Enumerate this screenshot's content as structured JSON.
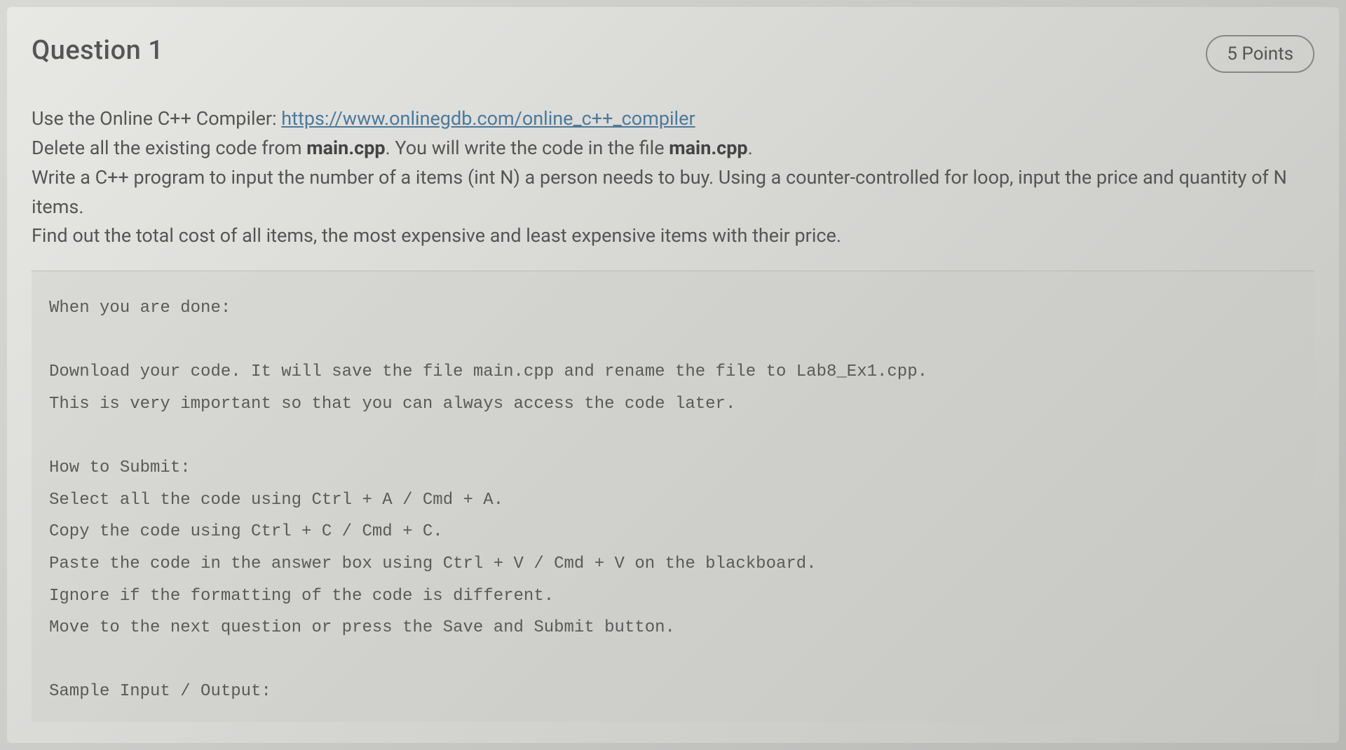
{
  "question": {
    "title": "Question 1",
    "points": "5 Points",
    "body": {
      "line1_prefix": "Use the Online C++ Compiler: ",
      "line1_link": "https://www.onlinegdb.com/online_c++_compiler",
      "line2_prefix": "Delete all the existing code from ",
      "line2_bold1": "main.cpp",
      "line2_mid": ". You will write the code in the file ",
      "line2_bold2": "main.cpp",
      "line2_suffix": ".",
      "line3": "Write a C++ program to input the number of a items (int N) a person needs to buy. Using a counter-controlled for loop, input the price and quantity of N items.",
      "line4": "Find out the total cost of all items, the most expensive and least expensive items with their price."
    },
    "codeblock": "When you are done:\n\nDownload your code. It will save the file main.cpp and rename the file to Lab8_Ex1.cpp.\nThis is very important so that you can always access the code later.\n\nHow to Submit:\nSelect all the code using Ctrl + A / Cmd + A.\nCopy the code using Ctrl + C / Cmd + C.\nPaste the code in the answer box using Ctrl + V / Cmd + V on the blackboard.\nIgnore if the formatting of the code is different.\nMove to the next question or press the Save and Submit button.\n\nSample Input / Output:"
  }
}
